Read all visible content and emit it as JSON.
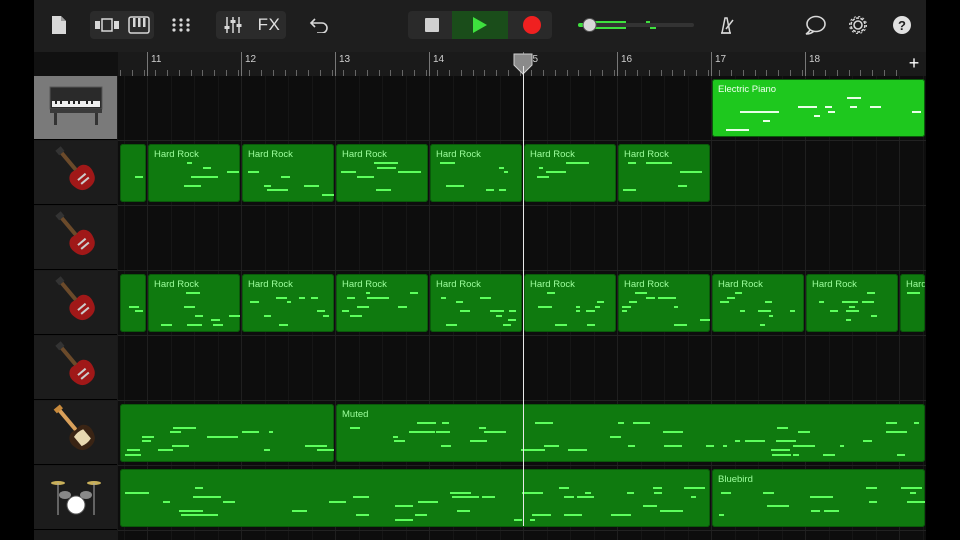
{
  "toolbar": {
    "fx_label": "FX",
    "help_label": "?",
    "volume_level": 0.1
  },
  "ruler": {
    "bars": [
      "11",
      "12",
      "13",
      "14",
      "15",
      "16",
      "17",
      "18"
    ],
    "add_label": "+"
  },
  "tracks": [
    {
      "instrument": "electric-piano",
      "selected": true
    },
    {
      "instrument": "electric-guitar",
      "selected": false
    },
    {
      "instrument": "electric-guitar",
      "selected": false
    },
    {
      "instrument": "electric-guitar",
      "selected": false
    },
    {
      "instrument": "electric-guitar",
      "selected": false
    },
    {
      "instrument": "bass-guitar",
      "selected": false
    },
    {
      "instrument": "drum-kit",
      "selected": false
    }
  ],
  "regions": [
    {
      "track": 0,
      "start": 17,
      "end": 19.3,
      "label": "Electric Piano",
      "bright": true
    },
    {
      "track": 1,
      "start": 10.7,
      "end": 11,
      "label": ""
    },
    {
      "track": 1,
      "start": 11,
      "end": 12,
      "label": "Hard Rock"
    },
    {
      "track": 1,
      "start": 12,
      "end": 13,
      "label": "Hard Rock"
    },
    {
      "track": 1,
      "start": 13,
      "end": 14,
      "label": "Hard Rock"
    },
    {
      "track": 1,
      "start": 14,
      "end": 15,
      "label": "Hard Rock"
    },
    {
      "track": 1,
      "start": 15,
      "end": 16,
      "label": "Hard Rock"
    },
    {
      "track": 1,
      "start": 16,
      "end": 17,
      "label": "Hard Rock"
    },
    {
      "track": 3,
      "start": 10.7,
      "end": 11,
      "label": ""
    },
    {
      "track": 3,
      "start": 11,
      "end": 12,
      "label": "Hard Rock"
    },
    {
      "track": 3,
      "start": 12,
      "end": 13,
      "label": "Hard Rock"
    },
    {
      "track": 3,
      "start": 13,
      "end": 14,
      "label": "Hard Rock"
    },
    {
      "track": 3,
      "start": 14,
      "end": 15,
      "label": "Hard Rock"
    },
    {
      "track": 3,
      "start": 15,
      "end": 16,
      "label": "Hard Rock"
    },
    {
      "track": 3,
      "start": 16,
      "end": 17,
      "label": "Hard Rock"
    },
    {
      "track": 3,
      "start": 17,
      "end": 18,
      "label": "Hard Rock"
    },
    {
      "track": 3,
      "start": 18,
      "end": 19,
      "label": "Hard Rock"
    },
    {
      "track": 3,
      "start": 19,
      "end": 19.3,
      "label": "Hard"
    },
    {
      "track": 5,
      "start": 10.7,
      "end": 13,
      "label": ""
    },
    {
      "track": 5,
      "start": 13,
      "end": 19.3,
      "label": "Muted"
    },
    {
      "track": 6,
      "start": 10.7,
      "end": 17,
      "label": ""
    },
    {
      "track": 6,
      "start": 17,
      "end": 19.3,
      "label": "Bluebird"
    }
  ],
  "playhead_bar": 15
}
